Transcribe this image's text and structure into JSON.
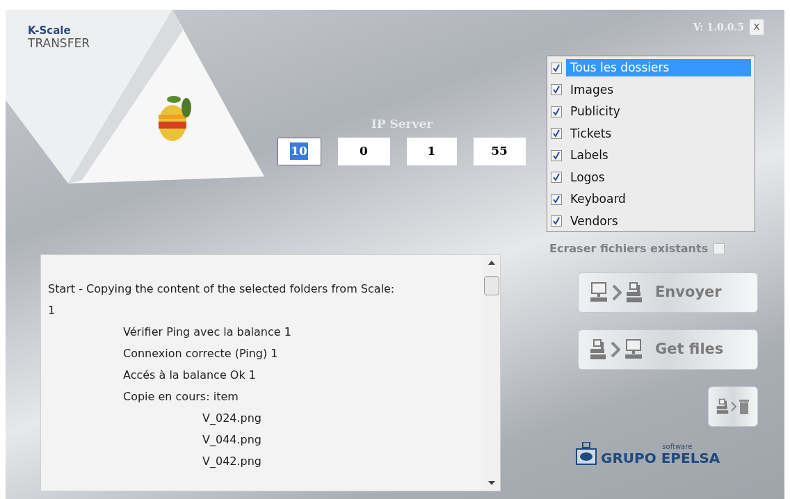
{
  "app": {
    "title_line_1": "K-Scale",
    "title_line_2": "TRANSFER",
    "version": "V: 1.0.0.5",
    "close_label": "X"
  },
  "ip_server": {
    "label": "IP Server",
    "octets": [
      {
        "value": "10",
        "selected": true
      },
      {
        "value": "0",
        "selected": false
      },
      {
        "value": "1",
        "selected": false
      },
      {
        "value": "55",
        "selected": false
      }
    ]
  },
  "folders": [
    {
      "label": "Tous les dossiers",
      "checked": true,
      "selected": true
    },
    {
      "label": "Images",
      "checked": true,
      "selected": false
    },
    {
      "label": "Publicity",
      "checked": true,
      "selected": false
    },
    {
      "label": "Tickets",
      "checked": true,
      "selected": false
    },
    {
      "label": "Labels",
      "checked": true,
      "selected": false
    },
    {
      "label": "Logos",
      "checked": true,
      "selected": false
    },
    {
      "label": "Keyboard",
      "checked": true,
      "selected": false
    },
    {
      "label": "Vendors",
      "checked": true,
      "selected": false
    }
  ],
  "overwrite": {
    "label": "Ecraser fichiers existants",
    "checked": false
  },
  "log": {
    "lines": [
      {
        "text": "Start - Copying the content of the selected folders from Scale: 1",
        "children": [
          {
            "text": "Vérifier Ping avec la balance 1"
          },
          {
            "text": "Connexion correcte (Ping) 1"
          },
          {
            "text": "Accés à la balance Ok 1"
          },
          {
            "text": "Copie en cours: item",
            "children": [
              {
                "text": "V_024.png"
              },
              {
                "text": "V_044.png"
              },
              {
                "text": "V_042.png"
              }
            ]
          }
        ]
      }
    ]
  },
  "buttons": [
    {
      "kind": "send",
      "label": "Envoyer"
    },
    {
      "kind": "receive",
      "label": "Get files"
    },
    {
      "kind": "delete"
    }
  ],
  "brand": {
    "tagline": "software",
    "name": "GRUPO EPELSA"
  }
}
